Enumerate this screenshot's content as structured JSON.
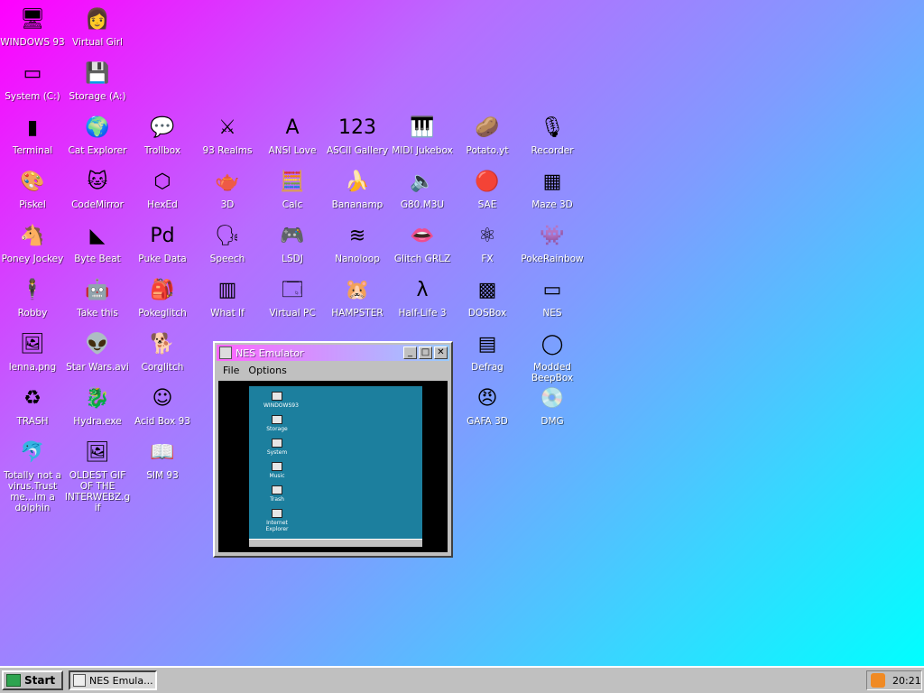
{
  "desktop": {
    "icons": [
      {
        "label": "WINDOWS 93",
        "icon": "computer-icon",
        "glyph": "🖥"
      },
      {
        "label": "Virtual Girl",
        "icon": "face-icon",
        "glyph": "👩"
      },
      {
        "label": "System (C:)",
        "icon": "drive-icon",
        "glyph": "▭"
      },
      {
        "label": "Storage (A:)",
        "icon": "floppy-drive-icon",
        "glyph": "💾"
      },
      {
        "label": "Terminal",
        "icon": "terminal-icon",
        "glyph": "▮"
      },
      {
        "label": "Cat Explorer",
        "icon": "globe-cat-icon",
        "glyph": "🌍"
      },
      {
        "label": "Trollbox",
        "icon": "chat-icon",
        "glyph": "💬"
      },
      {
        "label": "93 Realms",
        "icon": "sword-icon",
        "glyph": "⚔"
      },
      {
        "label": "ANSI Love",
        "icon": "letter-a-icon",
        "glyph": "A"
      },
      {
        "label": "ASCII Gallery",
        "icon": "numbers-icon",
        "glyph": "123"
      },
      {
        "label": "MIDI Jukebox",
        "icon": "piano-icon",
        "glyph": "🎹"
      },
      {
        "label": "Potato.yt",
        "icon": "potato-icon",
        "glyph": "🥔"
      },
      {
        "label": "Recorder",
        "icon": "microphone-icon",
        "glyph": "🎙"
      },
      {
        "label": "Piskel",
        "icon": "palette-icon",
        "glyph": "🎨"
      },
      {
        "label": "CodeMirror",
        "icon": "code-icon",
        "glyph": "🐱"
      },
      {
        "label": "HexEd",
        "icon": "cube-icon",
        "glyph": "⬡"
      },
      {
        "label": "3D",
        "icon": "teapot-icon",
        "glyph": "🫖"
      },
      {
        "label": "Calc",
        "icon": "calculator-icon",
        "glyph": "🧮"
      },
      {
        "label": "Bananamp",
        "icon": "banana-icon",
        "glyph": "🍌"
      },
      {
        "label": "G80.M3U",
        "icon": "audio-file-icon",
        "glyph": "🔈"
      },
      {
        "label": "SAE",
        "icon": "ball-icon",
        "glyph": "🔴"
      },
      {
        "label": "Maze 3D",
        "icon": "maze-icon",
        "glyph": "▦"
      },
      {
        "label": "Poney Jockey",
        "icon": "pony-icon",
        "glyph": "🐴"
      },
      {
        "label": "Byte Beat",
        "icon": "wave-icon",
        "glyph": "◣"
      },
      {
        "label": "Puke Data",
        "icon": "pd-icon",
        "glyph": "Pd"
      },
      {
        "label": "Speech",
        "icon": "speech-face-icon",
        "glyph": "🗣"
      },
      {
        "label": "LSDJ",
        "icon": "gameboy-icon",
        "glyph": "🎮"
      },
      {
        "label": "Nanoloop",
        "icon": "loop-icon",
        "glyph": "≋"
      },
      {
        "label": "Glitch GRLZ",
        "icon": "lips-icon",
        "glyph": "👄"
      },
      {
        "label": "FX",
        "icon": "atom-icon",
        "glyph": "⚛"
      },
      {
        "label": "PokeRainbow",
        "icon": "pokemon-icon",
        "glyph": "👾"
      },
      {
        "label": "Robby",
        "icon": "stick-figure-icon",
        "glyph": "🕴"
      },
      {
        "label": "Take this",
        "icon": "pixel-face-icon",
        "glyph": "🤖"
      },
      {
        "label": "Pokeglitch",
        "icon": "bag-icon",
        "glyph": "🎒"
      },
      {
        "label": "What If",
        "icon": "cage-icon",
        "glyph": "▥"
      },
      {
        "label": "Virtual PC",
        "icon": "window-icon",
        "glyph": "🗔"
      },
      {
        "label": "HAMPSTER",
        "icon": "hamster-icon",
        "glyph": "🐹"
      },
      {
        "label": "Half-Life 3",
        "icon": "lambda-icon",
        "glyph": "λ"
      },
      {
        "label": "DOSBox",
        "icon": "dosbox-icon",
        "glyph": "▩"
      },
      {
        "label": "NES",
        "icon": "nes-icon",
        "glyph": "▭"
      },
      {
        "label": "lenna.png",
        "icon": "image-file-icon",
        "glyph": "🖼"
      },
      {
        "label": "Star Wars.avi",
        "icon": "yoda-icon",
        "glyph": "👽"
      },
      {
        "label": "Corglitch",
        "icon": "corgi-icon",
        "glyph": "🐕"
      },
      {
        "label": "Defrag",
        "icon": "defrag-icon",
        "glyph": "▤"
      },
      {
        "label": "Modded BeepBox",
        "icon": "ring-icon",
        "glyph": "◯"
      },
      {
        "label": "TRASH",
        "icon": "trash-icon",
        "glyph": "♻"
      },
      {
        "label": "Hydra.exe",
        "icon": "hydra-icon",
        "glyph": "🐉"
      },
      {
        "label": "Acid Box 93",
        "icon": "smiley-icon",
        "glyph": "☺"
      },
      {
        "label": "GAFA 3D",
        "icon": "doom-face-icon",
        "glyph": "😠"
      },
      {
        "label": "DMG",
        "icon": "disk-image-icon",
        "glyph": "💿"
      },
      {
        "label": "Totally not a virus.Trust me...im a dolphin",
        "icon": "dolphin-icon",
        "glyph": "🐬"
      },
      {
        "label": "OLDEST GIF OF THE INTERWEBZ.gif",
        "icon": "gif-file-icon",
        "glyph": "🖼"
      },
      {
        "label": "SIM 93",
        "icon": "book-icon",
        "glyph": "📖"
      }
    ]
  },
  "nes_window": {
    "title": "NES Emulator",
    "menu": [
      "File",
      "Options"
    ],
    "buttons": {
      "minimize": "_",
      "maximize": "□",
      "close": "✕"
    },
    "mini_icons": [
      "WINDOWS93",
      "Storage",
      "System",
      "Music",
      "Trash",
      "Internet Explorer"
    ]
  },
  "taskbar": {
    "start_label": "Start",
    "tasks": [
      {
        "label": "NES Emula..."
      }
    ],
    "clock": "20:21"
  }
}
